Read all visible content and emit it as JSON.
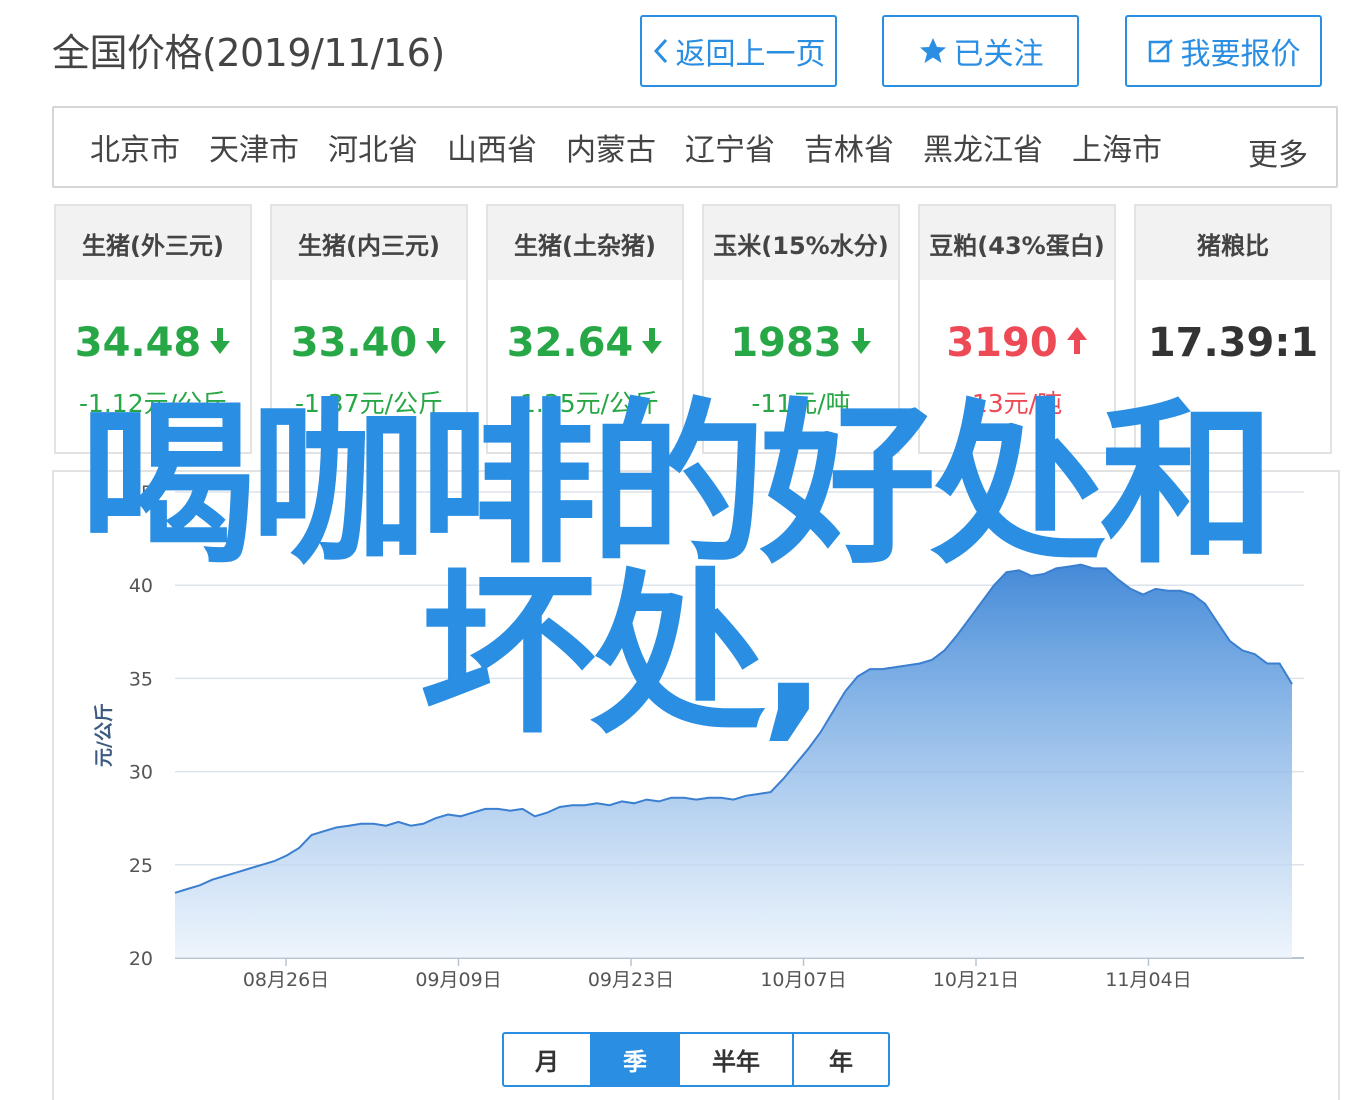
{
  "header": {
    "title": "全国价格(2019/11/16)",
    "back_label": "返回上一页",
    "followed_label": "已关注",
    "report_label": "我要报价"
  },
  "regions": {
    "items": [
      "北京市",
      "天津市",
      "河北省",
      "山西省",
      "内蒙古",
      "辽宁省",
      "吉林省",
      "黑龙江省",
      "上海市"
    ],
    "more_label": "更多"
  },
  "cards": [
    {
      "title": "生猪(外三元)",
      "value": "34.48",
      "trend": "down",
      "change": "-1.12元/公斤"
    },
    {
      "title": "生猪(内三元)",
      "value": "33.40",
      "trend": "down",
      "change": "-1.37元/公斤"
    },
    {
      "title": "生猪(土杂猪)",
      "value": "32.64",
      "trend": "down",
      "change": "-1.35元/公斤"
    },
    {
      "title": "玉米(15%水分)",
      "value": "1983",
      "trend": "down",
      "change": "-11元/吨"
    },
    {
      "title": "豆粕(43%蛋白)",
      "value": "3190",
      "trend": "up",
      "change": "13元/吨"
    },
    {
      "title": "猪粮比",
      "value": "17.39:1",
      "trend": "none",
      "change": ""
    }
  ],
  "colors": {
    "accent": "#2a8ee2",
    "down": "#27a745",
    "up": "#ee4a55",
    "area_top": "#3a84d6",
    "area_bottom": "#e6f0fb"
  },
  "chart_data": {
    "type": "area",
    "ylabel": "元/公斤",
    "ylim": [
      20,
      45
    ],
    "yticks": [
      20,
      25,
      30,
      35,
      40,
      45
    ],
    "grid": true,
    "xtick_labels": [
      "08月26日",
      "09月09日",
      "09月23日",
      "10月07日",
      "10月21日",
      "11月04日"
    ],
    "series": [
      {
        "values": [
          23.5,
          23.7,
          23.9,
          24.2,
          24.4,
          24.6,
          24.8,
          25.0,
          25.2,
          25.5,
          25.9,
          26.6,
          26.8,
          27.0,
          27.1,
          27.2,
          27.2,
          27.1,
          27.3,
          27.1,
          27.2,
          27.5,
          27.7,
          27.6,
          27.8,
          28.0,
          28.0,
          27.9,
          28.0,
          27.6,
          27.8,
          28.1,
          28.2,
          28.2,
          28.3,
          28.2,
          28.4,
          28.3,
          28.5,
          28.4,
          28.6,
          28.6,
          28.5,
          28.6,
          28.6,
          28.5,
          28.7,
          28.8,
          28.9,
          29.6,
          30.4,
          31.2,
          32.1,
          33.2,
          34.3,
          35.1,
          35.5,
          35.5,
          35.6,
          35.7,
          35.8,
          36.0,
          36.5,
          37.3,
          38.2,
          39.1,
          40.0,
          40.7,
          40.8,
          40.5,
          40.6,
          40.9,
          41.0,
          41.1,
          40.9,
          40.9,
          40.3,
          39.8,
          39.5,
          39.8,
          39.7,
          39.7,
          39.5,
          39.0,
          38.0,
          37.0,
          36.5,
          36.3,
          35.8,
          35.8,
          34.7
        ]
      }
    ]
  },
  "period_tabs": {
    "items": [
      "月",
      "季",
      "半年",
      "年"
    ],
    "active": "季"
  },
  "overlay": {
    "line1": "喝咖啡的好处和",
    "line2": "坏处,"
  }
}
